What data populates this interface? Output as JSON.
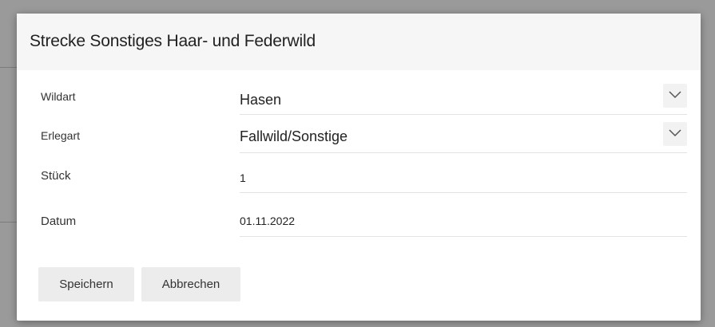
{
  "dialog": {
    "title": "Strecke Sonstiges Haar- und Federwild"
  },
  "form": {
    "wildart": {
      "label": "Wildart",
      "value": "Hasen",
      "dropdown_icon": "chevron-down-icon"
    },
    "erlegart": {
      "label": "Erlegart",
      "value": "Fallwild/Sonstige",
      "dropdown_icon": "chevron-down-icon"
    },
    "stueck": {
      "label": "Stück",
      "value": "1"
    },
    "datum": {
      "label": "Datum",
      "value": "01.11.2022"
    }
  },
  "buttons": {
    "save_label": "Speichern",
    "cancel_label": "Abbrechen"
  },
  "colors": {
    "header_bg": "#f6f6f6",
    "button_bg": "#ececec",
    "backdrop": "#9a9a9a"
  }
}
